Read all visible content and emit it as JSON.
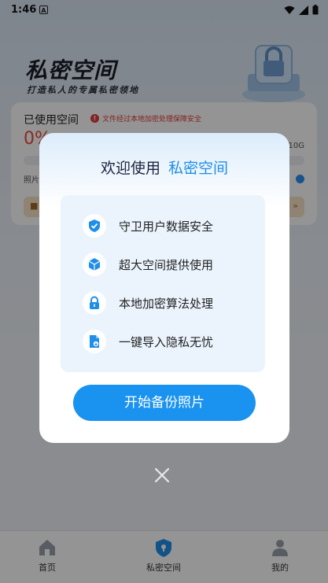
{
  "status_bar": {
    "time": "1:46",
    "notification_letter": "A"
  },
  "hero": {
    "title": "私密空间",
    "subtitle": "打造私人的专属私密领地"
  },
  "storage_card": {
    "title": "已使用空间",
    "warning": "文件经过本地加密处理保障安全",
    "percent": "0%",
    "capacity": "/10G",
    "used_fraction": 0,
    "photos_label": "照片"
  },
  "dialog": {
    "title_prefix": "欢迎使用",
    "title_accent": "私密空间",
    "features": [
      {
        "icon": "shield-check-icon",
        "text": "守卫用户数据安全"
      },
      {
        "icon": "cube-icon",
        "text": "超大空间提供使用"
      },
      {
        "icon": "lock-icon",
        "text": "本地加密算法处理"
      },
      {
        "icon": "file-import-icon",
        "text": "一键导入隐私无忧"
      }
    ],
    "start_button": "开始备份照片"
  },
  "tabbar": {
    "items": [
      {
        "label": "首页",
        "icon": "home-icon"
      },
      {
        "label": "私密空间",
        "icon": "shield-icon"
      },
      {
        "label": "我的",
        "icon": "user-icon"
      }
    ]
  },
  "colors": {
    "accent": "#1e8ee8",
    "button": "#1992f0",
    "warning": "#e23b3b",
    "percent": "#f04a3a"
  }
}
